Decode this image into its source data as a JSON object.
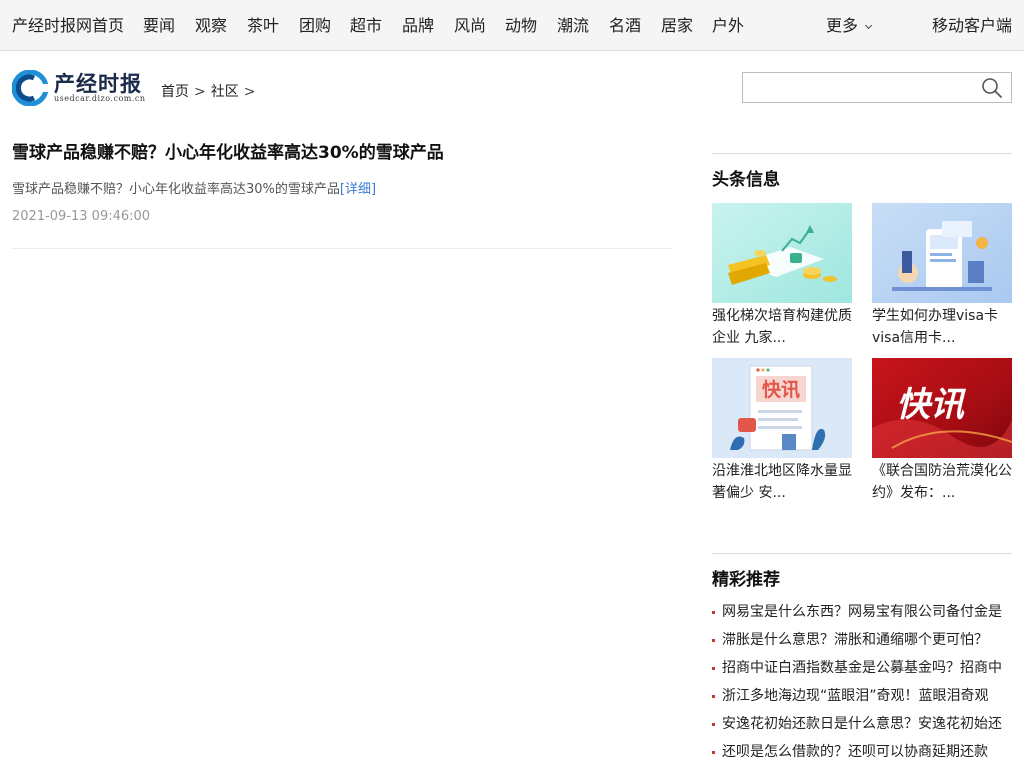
{
  "nav": {
    "items": [
      "产经时报网首页",
      "要闻",
      "观察",
      "茶叶",
      "团购",
      "超市",
      "品牌",
      "风尚",
      "动物",
      "潮流",
      "名酒",
      "居家",
      "户外"
    ],
    "more_label": "更多",
    "mobile_label": "移动客户端"
  },
  "logo": {
    "title": "产经时报",
    "subtitle": "usedcar.dizo.com.cn"
  },
  "breadcrumb": {
    "home": "首页",
    "section": "社区",
    "separator": ">"
  },
  "search": {
    "placeholder": "",
    "icon": "search-icon"
  },
  "article": {
    "title": "雪球产品稳赚不赔？小心年化收益率高达30%的雪球产品",
    "summary": "雪球产品稳赚不赔？小心年化收益率高达30%的雪球产品",
    "detail_link": "[详细]",
    "date": "2021-09-13 09:46:00"
  },
  "headlines": {
    "title": "头条信息",
    "cards": [
      {
        "caption": "强化梯次培育构建优质企业 九家...",
        "image": "finance-coins-illustration"
      },
      {
        "caption": "学生如何办理visa卡 visa信用卡...",
        "image": "finance-phone-illustration"
      },
      {
        "caption": "沿淮淮北地区降水量显著偏少 安...",
        "image": "news-flash-illustration",
        "badge": "快讯"
      },
      {
        "caption": "《联合国防治荒漠化公约》发布：...",
        "image": "news-flash-red-banner",
        "badge": "快讯"
      }
    ]
  },
  "recommend": {
    "title": "精彩推荐",
    "items": [
      "网易宝是什么东西？网易宝有限公司备付金是",
      "滞胀是什么意思？滞胀和通缩哪个更可怕？",
      "招商中证白酒指数基金是公募基金吗？招商中",
      "浙江多地海边现“蓝眼泪”奇观！蓝眼泪奇观",
      "安逸花初始还款日是什么意思？安逸花初始还",
      "还呗是怎么借款的？还呗可以协商延期还款"
    ]
  },
  "colors": {
    "topbar_bg": "#f5f5f5",
    "link_blue": "#3a7bd5",
    "bullet_red": "#c0392b",
    "logo_blue": "#1f8fd6"
  }
}
